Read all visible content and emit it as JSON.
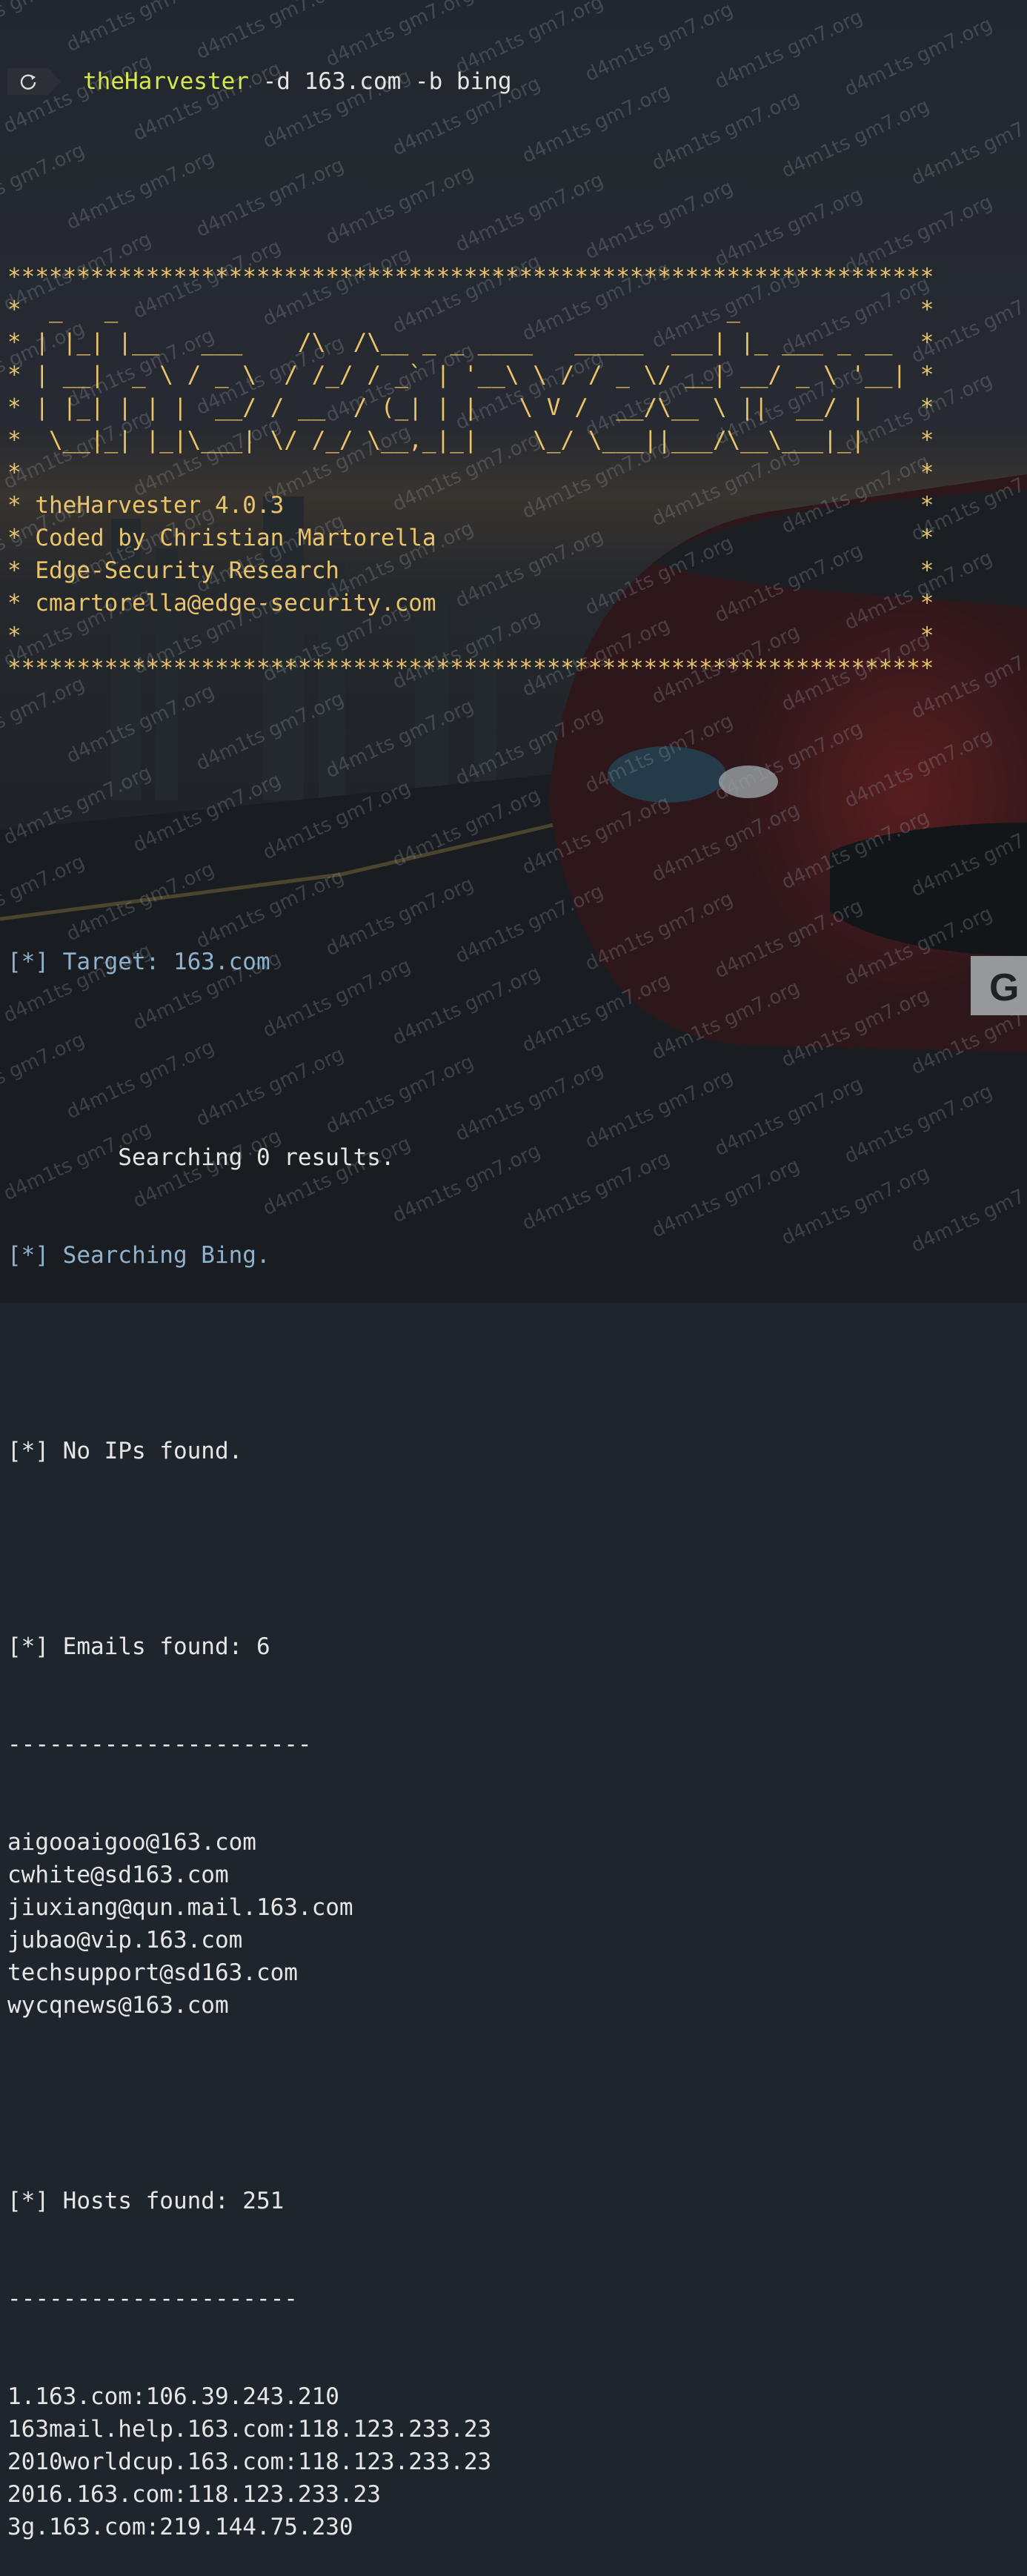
{
  "prompt": {
    "icon": "refresh-icon",
    "command": "theHarvester",
    "args": " -d 163.com -b bing"
  },
  "banner": {
    "lines": [
      "*******************************************************************",
      "*  _   _                                            _             *",
      "* | |_| |__   ___    /\\  /\\__ _ _ ____   _____  ___| |_ ___ _ __  *",
      "* | __|  _ \\ / _ \\  / /_/ / _` | '__\\ \\ / / _ \\/ __| __/ _ \\ '__| *",
      "* | |_| | | |  __/ / __  / (_| | |   \\ V /  __/\\__ \\ ||  __/ |    *",
      "*  \\__|_| |_|\\___| \\/ /_/ \\__,_|_|    \\_/ \\___||___/\\__\\___|_|    *",
      "*                                                                 *",
      "* theHarvester 4.0.3                                              *",
      "* Coded by Christian Martorella                                   *",
      "* Edge-Security Research                                          *",
      "* cmartorella@edge-security.com                                   *",
      "*                                                                 *",
      "*******************************************************************"
    ]
  },
  "target_line": "[*] Target: 163.com",
  "searching_results": "        Searching 0 results.",
  "searching_bing": "[*] Searching Bing.",
  "no_ips": "[*] No IPs found.",
  "emails": {
    "header": "[*] Emails found: 6",
    "separator": "----------------------",
    "items": [
      "aigooaigoo@163.com",
      "cwhite@sd163.com",
      "jiuxiang@qun.mail.163.com",
      "jubao@vip.163.com",
      "techsupport@sd163.com",
      "wycqnews@163.com"
    ]
  },
  "hosts": {
    "header": "[*] Hosts found: 251",
    "separator": "---------------------",
    "items": [
      "1.163.com:106.39.243.210",
      "163mail.help.163.com:118.123.233.23",
      "2010worldcup.163.com:118.123.233.23",
      "2016.163.com:118.123.233.23",
      "3g.163.com:219.144.75.230"
    ]
  },
  "watermark": "d4m1ts gm7.org",
  "colors": {
    "banner": "#e9c46a",
    "info": "#8fb3cf",
    "command": "#d7e84e",
    "text": "#e6e6e6"
  }
}
